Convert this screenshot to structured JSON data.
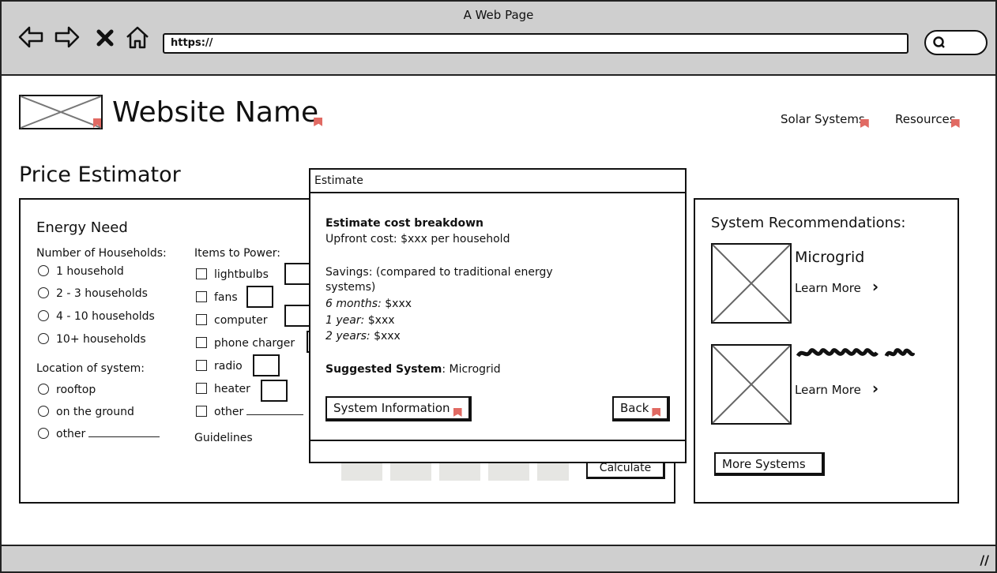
{
  "browser": {
    "title": "A Web Page",
    "url": "https://"
  },
  "header": {
    "site_name": "Website Name",
    "nav": [
      "Solar Systems",
      "Resources"
    ]
  },
  "page": {
    "title": "Price Estimator"
  },
  "energy_need": {
    "title": "Energy Need",
    "households_label": "Number of Households:",
    "households_options": [
      "1 household",
      "2 - 3 households",
      "4 - 10 households",
      "10+ households"
    ],
    "location_label": "Location of system:",
    "location_options": [
      "rooftop",
      "on the ground",
      "other"
    ],
    "items_label": "Items to Power:",
    "items": [
      "lightbulbs",
      "fans",
      "computer",
      "phone charger",
      "radio",
      "heater",
      "other"
    ],
    "guidelines_link": "Guidelines",
    "calculate_label": "Calculate"
  },
  "recommendations": {
    "title": "System Recommendations:",
    "items": [
      {
        "name": "Microgrid",
        "learn_more": "Learn More"
      },
      {
        "learn_more": "Learn More"
      }
    ],
    "more_systems_label": "More Systems"
  },
  "modal": {
    "title": "Estimate",
    "breakdown_heading": "Estimate cost breakdown",
    "upfront": "Upfront cost: $xxx per household",
    "savings_line1": "Savings: (compared to traditional energy",
    "savings_line2": "systems)",
    "savings_rows": [
      {
        "period": "6 months:",
        "value": "$xxx"
      },
      {
        "period": "1 year:",
        "value": "$xxx"
      },
      {
        "period": "2 years:",
        "value": "$xxx"
      }
    ],
    "suggested_label": "Suggested System",
    "suggested_value": ": Microgrid",
    "system_info_label": "System Information",
    "back_label": "Back"
  },
  "colors": {
    "chrome": "#cfcfcf",
    "flag": "#e16a63"
  }
}
